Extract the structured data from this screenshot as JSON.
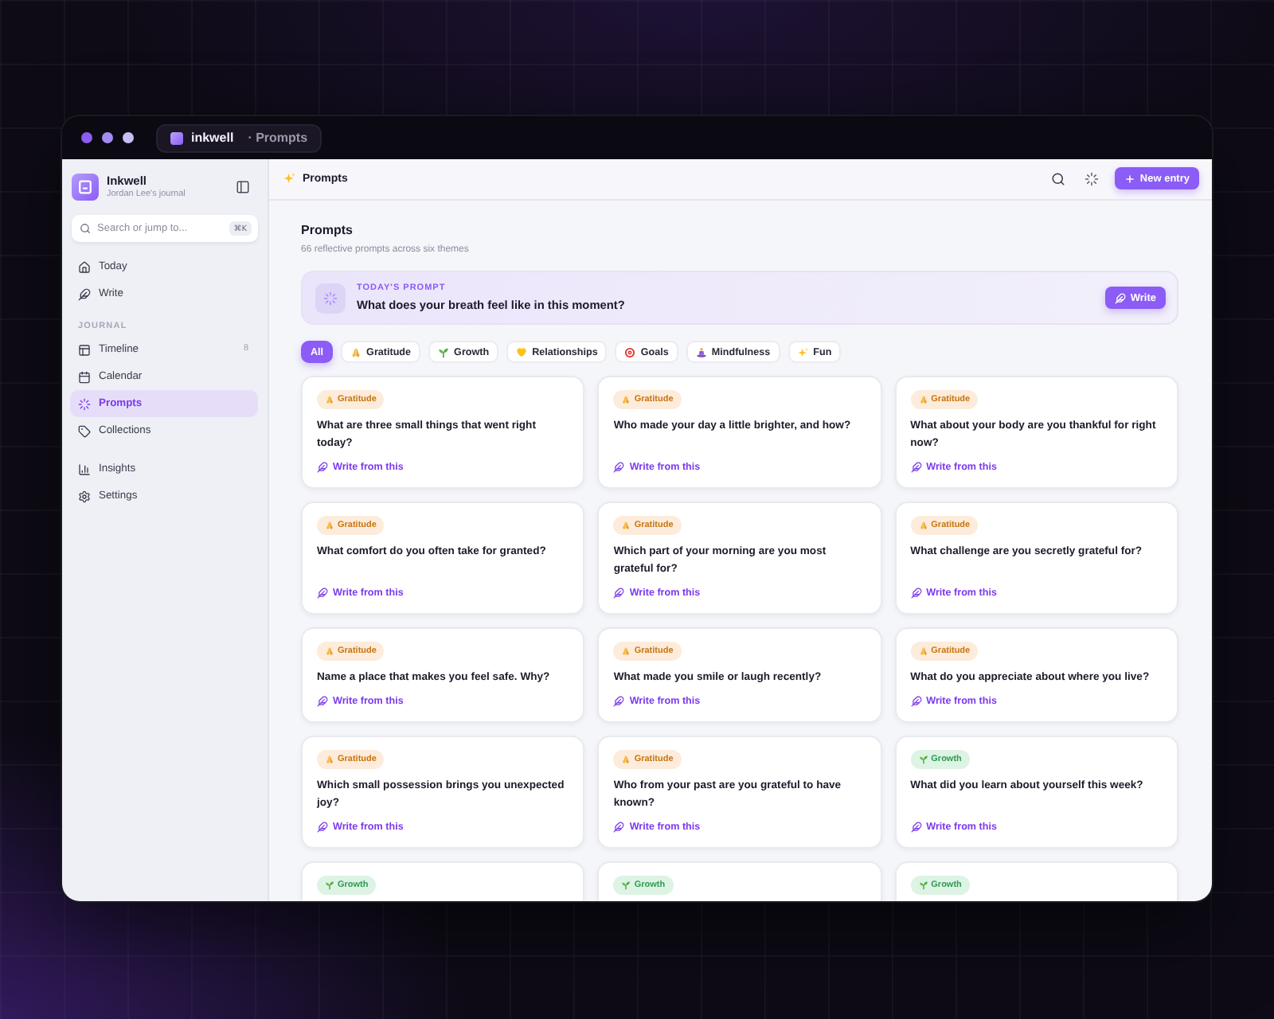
{
  "window": {
    "app_name": "inkwell",
    "page_name": "· Prompts"
  },
  "sidebar": {
    "brand": "Inkwell",
    "owner": "Jordan Lee's journal",
    "search": {
      "placeholder": "Search or jump to...",
      "shortcut": "⌘K"
    },
    "groups": [
      {
        "items": [
          {
            "kind": "home",
            "label": "Today",
            "selected": false
          },
          {
            "kind": "write",
            "label": "Write",
            "selected": false
          }
        ]
      },
      {
        "heading": "JOURNAL",
        "items": [
          {
            "kind": "timeline",
            "label": "Timeline",
            "count": "8",
            "selected": false
          },
          {
            "kind": "calendar",
            "label": "Calendar",
            "selected": false
          },
          {
            "kind": "prompts",
            "label": "Prompts",
            "selected": true
          },
          {
            "kind": "collections",
            "label": "Collections",
            "selected": false
          }
        ]
      },
      {
        "items": [
          {
            "kind": "insights",
            "label": "Insights",
            "selected": false
          },
          {
            "kind": "settings",
            "label": "Settings",
            "selected": false
          }
        ]
      }
    ]
  },
  "topbar": {
    "title": "Prompts",
    "new_entry_button": "New entry"
  },
  "page": {
    "heading": "Prompts",
    "subtitle": "66 reflective prompts across six themes"
  },
  "todays_prompt": {
    "label": "TODAY'S PROMPT",
    "question": "What does your breath feel like in this moment?",
    "button": "Write"
  },
  "filters": [
    {
      "kind": "all",
      "label": "All",
      "selected": true
    },
    {
      "kind": "gratitude",
      "label": "Gratitude",
      "selected": false
    },
    {
      "kind": "growth",
      "label": "Growth",
      "selected": false
    },
    {
      "kind": "relationships",
      "label": "Relationships",
      "selected": false
    },
    {
      "kind": "goals",
      "label": "Goals",
      "selected": false
    },
    {
      "kind": "mindfulness",
      "label": "Mindfulness",
      "selected": false
    },
    {
      "kind": "fun",
      "label": "Fun",
      "selected": false
    }
  ],
  "cards": [
    {
      "kind": "gratitude",
      "tag": "Gratitude",
      "question": "What are three small things that went right today?",
      "link": "Write from this"
    },
    {
      "kind": "gratitude",
      "tag": "Gratitude",
      "question": "Who made your day a little brighter, and how?",
      "link": "Write from this"
    },
    {
      "kind": "gratitude",
      "tag": "Gratitude",
      "question": "What about your body are you thankful for right now?",
      "link": "Write from this"
    },
    {
      "kind": "gratitude",
      "tag": "Gratitude",
      "question": "What comfort do you often take for granted?",
      "link": "Write from this"
    },
    {
      "kind": "gratitude",
      "tag": "Gratitude",
      "question": "Which part of your morning are you most grateful for?",
      "link": "Write from this"
    },
    {
      "kind": "gratitude",
      "tag": "Gratitude",
      "question": "What challenge are you secretly grateful for?",
      "link": "Write from this"
    },
    {
      "kind": "gratitude",
      "tag": "Gratitude",
      "question": "Name a place that makes you feel safe. Why?",
      "link": "Write from this"
    },
    {
      "kind": "gratitude",
      "tag": "Gratitude",
      "question": "What made you smile or laugh recently?",
      "link": "Write from this"
    },
    {
      "kind": "gratitude",
      "tag": "Gratitude",
      "question": "What do you appreciate about where you live?",
      "link": "Write from this"
    },
    {
      "kind": "gratitude",
      "tag": "Gratitude",
      "question": "Which small possession brings you unexpected joy?",
      "link": "Write from this"
    },
    {
      "kind": "gratitude",
      "tag": "Gratitude",
      "question": "Who from your past are you grateful to have known?",
      "link": "Write from this"
    },
    {
      "kind": "growth",
      "tag": "Growth",
      "question": "What did you learn about yourself this week?",
      "link": "Write from this"
    },
    {
      "kind": "growth",
      "tag": "Growth"
    },
    {
      "kind": "growth",
      "tag": "Growth"
    },
    {
      "kind": "growth",
      "tag": "Growth"
    }
  ]
}
